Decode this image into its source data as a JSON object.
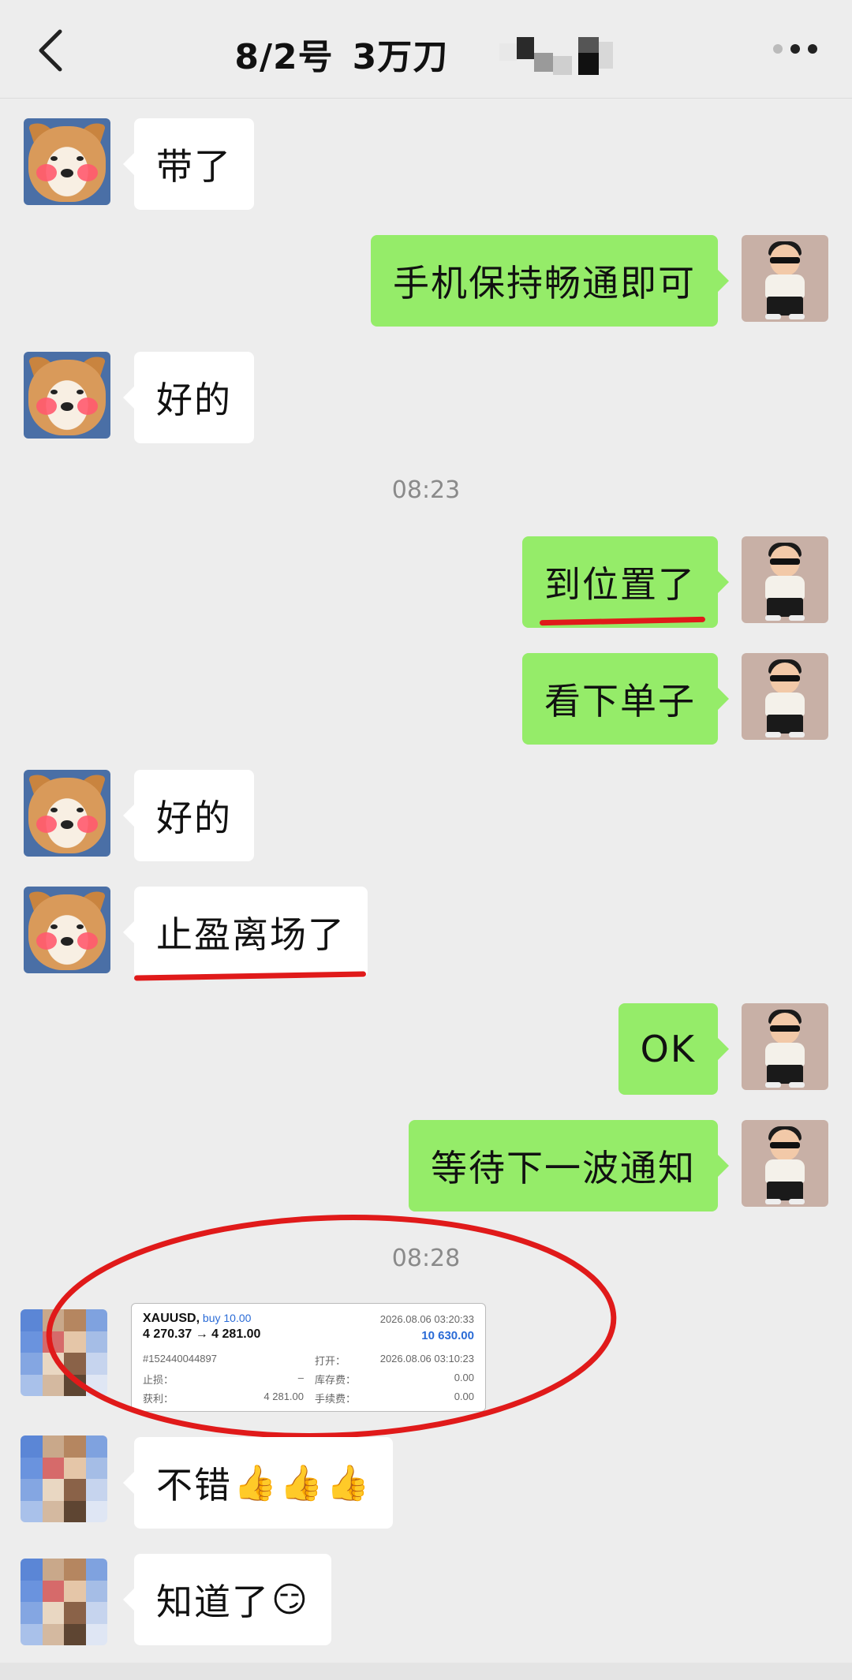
{
  "header": {
    "title_part1": "8/2号",
    "title_part2": "3万刀"
  },
  "messages": [
    {
      "side": "in",
      "text": "带了"
    },
    {
      "side": "out",
      "text": "手机保持畅通即可"
    },
    {
      "side": "in",
      "text": "好的"
    },
    {
      "side": "out",
      "text": "到位置了"
    },
    {
      "side": "out",
      "text": "看下单子"
    },
    {
      "side": "in",
      "text": "好的"
    },
    {
      "side": "in",
      "text": "止盈离场了"
    },
    {
      "side": "out",
      "text": "OK"
    },
    {
      "side": "out",
      "text": "等待下一波通知"
    },
    {
      "side": "in",
      "text": "不错"
    },
    {
      "side": "in",
      "text": "知道了"
    }
  ],
  "timestamps": [
    "08:23",
    "08:28"
  ],
  "trade_card": {
    "symbol": "XAUUSD,",
    "side": "buy 10.00",
    "prices": "4 270.37 → 4 281.00",
    "close_time": "2026.08.06 03:20:33",
    "profit_value": "10 630.00",
    "order_id": "#152440044897",
    "open_label": "打开：",
    "open_time": "2026.08.06 03:10:23",
    "sl_label": "止损：",
    "sl_value": "–",
    "swap_label": "库存费：",
    "swap_value": "0.00",
    "tp_label": "获利：",
    "tp_value": "4 281.00",
    "fee_label": "手续费：",
    "fee_value": "0.00"
  },
  "emojis": {
    "thumbs_up": "👍",
    "smirk": "😏"
  },
  "colors": {
    "background": "#ededed",
    "outgoing_bubble": "#95ec69",
    "incoming_bubble": "#ffffff",
    "annotation_red": "#e01a1a"
  }
}
